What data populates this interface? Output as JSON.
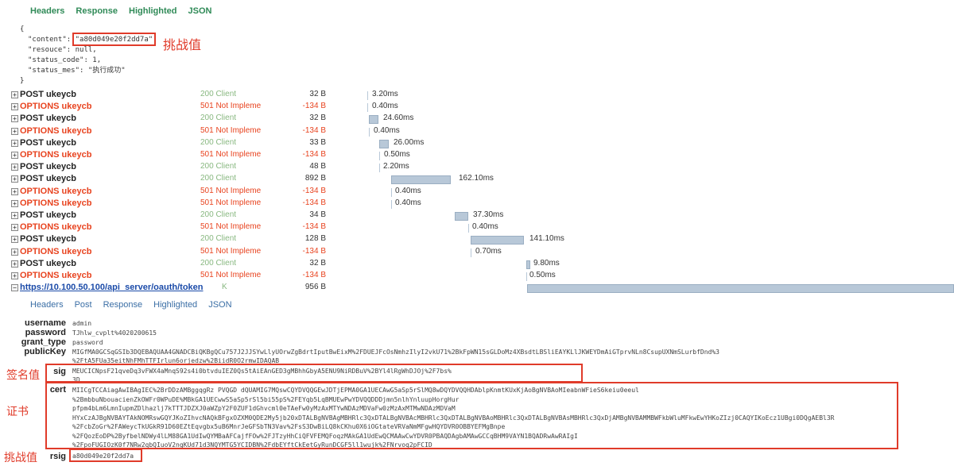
{
  "top_tabs": [
    "Headers",
    "Response",
    "Highlighted",
    "JSON"
  ],
  "response_json": {
    "open": "{",
    "content_key": "\"content\"",
    "content_val": "\"a80d049e20f2dd7a\",",
    "resouce_line": "\"resouce\": null,",
    "status_code_line": "\"status_code\": 1,",
    "status_mes_line": "\"status_mes\": \"执行成功\"",
    "close": "}"
  },
  "annotations": {
    "challenge_top": "挑战值",
    "signature": "签名值",
    "certificate": "证书",
    "challenge_bottom": "挑战值"
  },
  "requests": [
    {
      "type": "post",
      "name": "POST ukeycb",
      "status": "200 Client",
      "size": "32 B",
      "time": "3.20ms"
    },
    {
      "type": "opt",
      "name": "OPTIONS ukeycb",
      "status": "501 Not Impleme",
      "size": "-134 B",
      "time": "0.40ms"
    },
    {
      "type": "post",
      "name": "POST ukeycb",
      "status": "200 Client",
      "size": "32 B",
      "time": "24.60ms"
    },
    {
      "type": "opt",
      "name": "OPTIONS ukeycb",
      "status": "501 Not Impleme",
      "size": "-134 B",
      "time": "0.40ms"
    },
    {
      "type": "post",
      "name": "POST ukeycb",
      "status": "200 Client",
      "size": "33 B",
      "time": "26.00ms"
    },
    {
      "type": "opt",
      "name": "OPTIONS ukeycb",
      "status": "501 Not Impleme",
      "size": "-134 B",
      "time": "0.50ms"
    },
    {
      "type": "post",
      "name": "POST ukeycb",
      "status": "200 Client",
      "size": "48 B",
      "time": "2.20ms"
    },
    {
      "type": "post",
      "name": "POST ukeycb",
      "status": "200 Client",
      "size": "892 B",
      "time": "162.10ms"
    },
    {
      "type": "opt",
      "name": "OPTIONS ukeycb",
      "status": "501 Not Impleme",
      "size": "-134 B",
      "time": "0.40ms"
    },
    {
      "type": "opt",
      "name": "OPTIONS ukeycb",
      "status": "501 Not Impleme",
      "size": "-134 B",
      "time": "0.40ms"
    },
    {
      "type": "post",
      "name": "POST ukeycb",
      "status": "200 Client",
      "size": "34 B",
      "time": "37.30ms"
    },
    {
      "type": "opt",
      "name": "OPTIONS ukeycb",
      "status": "501 Not Impleme",
      "size": "-134 B",
      "time": "0.40ms"
    },
    {
      "type": "post",
      "name": "POST ukeycb",
      "status": "200 Client",
      "size": "128 B",
      "time": "141.10ms"
    },
    {
      "type": "opt",
      "name": "OPTIONS ukeycb",
      "status": "501 Not Impleme",
      "size": "-134 B",
      "time": "0.70ms"
    },
    {
      "type": "post",
      "name": "POST ukeycb",
      "status": "200 Client",
      "size": "32 B",
      "time": "9.80ms"
    },
    {
      "type": "opt",
      "name": "OPTIONS ukeycb",
      "status": "501 Not Impleme",
      "size": "-134 B",
      "time": "0.50ms"
    }
  ],
  "token_request": {
    "expand": "−",
    "url": "https://10.100.50.100/api_server/oauth/token",
    "status": "K",
    "size": "956 B"
  },
  "bottom_tabs": [
    "Headers",
    "Post",
    "Response",
    "Highlighted",
    "JSON"
  ],
  "params": {
    "username_label": "username",
    "username": "admin",
    "password_label": "password",
    "password": "TJhlw_cvplt%4020200615",
    "grant_type_label": "grant_type",
    "grant_type": "password",
    "publickey_label": "publicKey",
    "publickey_1": "MIGfMA0GCSqGSIb3DQEBAQUAA4GNADCBiQKBgQCu757J2JJSYwLlyUOrwZgBdrtIputBwEixM%2FDUEJFcOsNmhzIlyI2vkU71%2BkFpWN15sGLDoMz4XBsdtLBSliEAYKLlJKWEYDmAiGTprvNLn8CsupUXNmSLurbfDnd%3",
    "publickey_2": "%2FtA5FUa35eitNhFMhTTFIrlun6orjedzw%2BiidR0O2rmwIDAQAB",
    "sig_label": "sig",
    "sig_1": "MEUCICNpsF21qveDq3vFWX4aMnqS92s4i0btvduIEZ0Qs5tAiEAnGED3gMBhhGbyA5ENU9NiRDBuV%2BYl4lRgWhDJOj%2F7bs%",
    "sig_2": "3D",
    "cert_label": "cert",
    "cert_lines": [
      "MIICgTCCAiagAwIBAgIEC%2BrDDzAMBggqgRz PVQGD dQUAMIG7MQswCQYDVQQGEwJDTjEPMA0GA1UECAwG5aSp5rSlMQ8wDQYDVQQHDAblpKnmtKUxKjAoBgNVBAoMIeabnWFieS6keiu0eeul",
      "%2BmbbuNbouacienZkOWFr0WPuDE%MBkGA1UECwwS5aSp5rSl5bi55pS%2FEYqb5LqBMUEwPwYDVQQDDDjmn5nlhYnluupHorgHur",
      "pfpm4bLm6LmnIupmZDlhazlj7kTTTJDZXJ0aWZpY2F0ZUF1dGhvcml0eTAeFw0yMzAxMTYwNDAzMDVaFw0zMzAxMTMwNDAzMDVaM",
      "HYxCzAJBgNVBAYTAkNOMRswGQYJKoZIhvcNAQkBFgxOZXM0QDE2My5jb20xDTALBgNVBAgMBHRlc3QxDTALBgNVBAcMBHRlc3QxDTALBgNVBAoMBHRlc3QxDTALBgNVBAsMBHRlc3QxDjAMBgNVBAMMBWFkbWluMFkwEwYHKoZIzj0CAQYIKoEcz1UBgi0DQgAEBl3R",
      "%2FcbZoGr%2FAWeycTkUGkR91D60EZtEqvgbx5uB6MnrJeGFSbTN3Vav%2FsS3DwBiLQ8kCKhu0X6iOGtateVRVaNmMFgwHQYDVR0OBBYEFMgBnpe",
      "%2FQozEoDP%2ByfbelNDWy4lLM88GA1UdIwQYMBaAFCajfFOw%2FJTzyHhCiQFVFEMQFoqzMAkGA1UdEwQCMAAwCwYDVR0PBAQDAgbAMAwGCCqBHM9VAYN1BQADRwAwRAIgI",
      "%2FpoFUGIOzK0f7NRw2qbQIuoV2ngKUd71d3NQYMTG5YCIDBN%2FdbEYftCkEetGyRunDCGF5ll1wujk%2FNrvoq2pFCID"
    ],
    "rsig_label": "rsig",
    "rsig": "a80d049e20f2dd7a"
  }
}
